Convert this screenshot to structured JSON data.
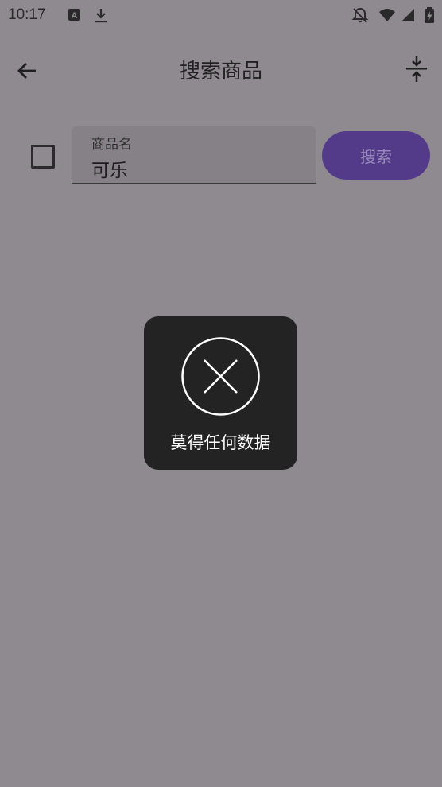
{
  "status_bar": {
    "time": "10:17",
    "icons": [
      "app-notification-icon",
      "download-icon",
      "notifications-off-icon",
      "wifi-icon",
      "signal-icon",
      "battery-icon"
    ]
  },
  "app_bar": {
    "title": "搜索商品",
    "back_icon": "arrow-back-icon",
    "collapse_icon": "vertical-align-center-icon"
  },
  "search": {
    "checkbox_checked": false,
    "field_label": "商品名",
    "field_value": "可乐",
    "button_label": "搜索"
  },
  "toast": {
    "icon": "close-circle-icon",
    "message": "莫得任何数据"
  },
  "colors": {
    "background": "#8f8a90",
    "button": "#533b8a",
    "toast": "#232323"
  }
}
